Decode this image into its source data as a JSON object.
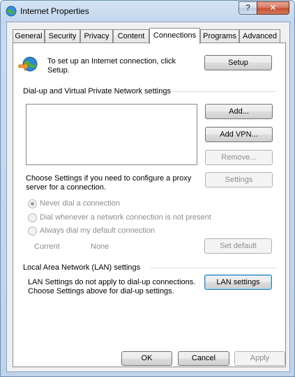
{
  "window": {
    "title": "Internet Properties",
    "help_glyph": "?",
    "close_glyph": "✕"
  },
  "tabs": [
    {
      "label": "General"
    },
    {
      "label": "Security"
    },
    {
      "label": "Privacy"
    },
    {
      "label": "Content"
    },
    {
      "label": "Connections",
      "active": true
    },
    {
      "label": "Programs"
    },
    {
      "label": "Advanced"
    }
  ],
  "setup": {
    "text_line1": "To set up an Internet connection, click",
    "text_line2": "Setup.",
    "button": "Setup"
  },
  "dialup": {
    "heading": "Dial-up and Virtual Private Network settings",
    "add_button": "Add...",
    "add_vpn_button": "Add VPN...",
    "remove_button": "Remove...",
    "settings_button": "Settings",
    "proxy_text_line1": "Choose Settings if you need to configure a proxy",
    "proxy_text_line2": "server for a connection.",
    "options": [
      {
        "label": "Never dial a connection",
        "checked": true
      },
      {
        "label": "Dial whenever a network connection is not present",
        "checked": false
      },
      {
        "label": "Always dial my default connection",
        "checked": false
      }
    ],
    "current_label": "Current",
    "current_value": "None",
    "set_default_button": "Set default"
  },
  "lan": {
    "heading": "Local Area Network (LAN) settings",
    "text_line1": "LAN Settings do not apply to dial-up connections.",
    "text_line2": "Choose Settings above for dial-up settings.",
    "button": "LAN settings"
  },
  "footer": {
    "ok": "OK",
    "cancel": "Cancel",
    "apply": "Apply"
  }
}
